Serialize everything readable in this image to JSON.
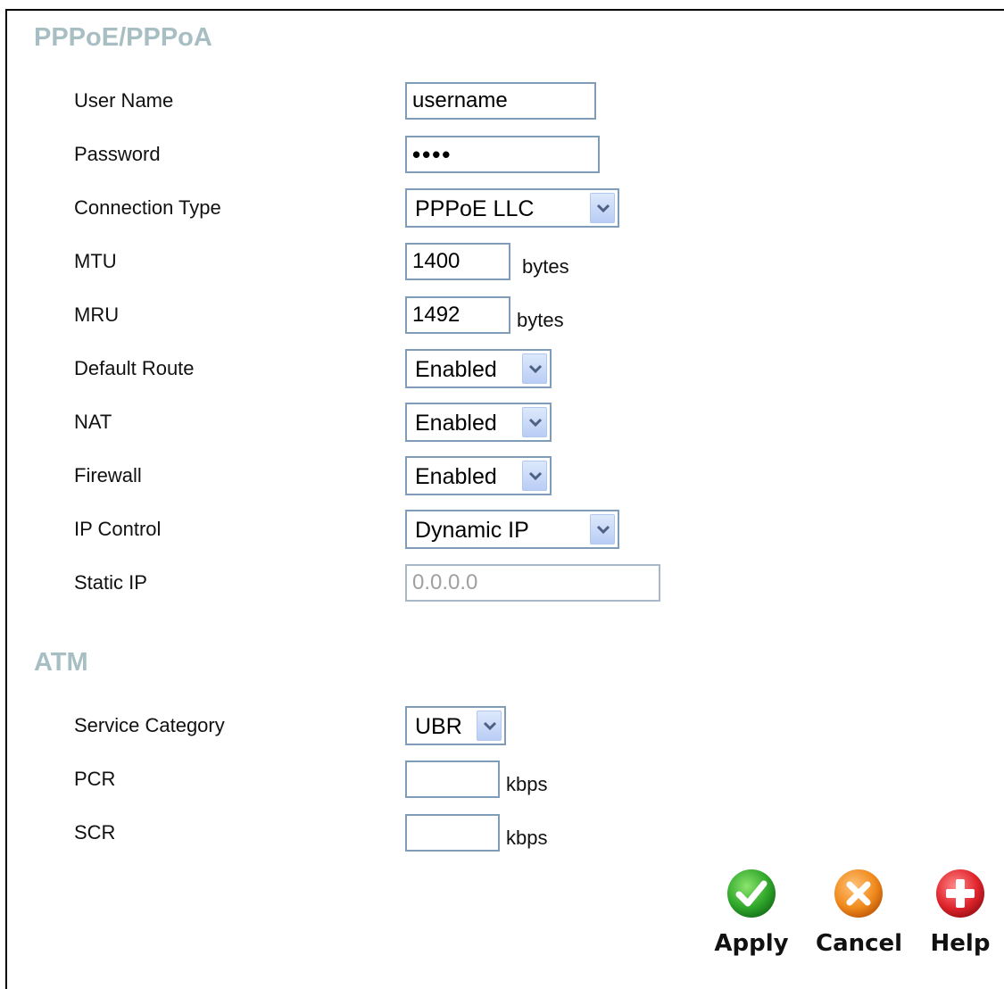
{
  "pppoe": {
    "heading": "PPPoE/PPPoA",
    "username_label": "User Name",
    "username_value": "username",
    "password_label": "Password",
    "password_value": "••••",
    "conn_type_label": "Connection Type",
    "conn_type_value": "PPPoE LLC",
    "mtu_label": "MTU",
    "mtu_value": "1400",
    "mtu_unit": "bytes",
    "mru_label": "MRU",
    "mru_value": "1492",
    "mru_unit": "bytes",
    "default_route_label": "Default Route",
    "default_route_value": "Enabled",
    "nat_label": "NAT",
    "nat_value": "Enabled",
    "firewall_label": "Firewall",
    "firewall_value": "Enabled",
    "ip_control_label": "IP Control",
    "ip_control_value": "Dynamic IP",
    "static_ip_label": "Static IP",
    "static_ip_value": "0.0.0.0"
  },
  "atm": {
    "heading": "ATM",
    "service_category_label": "Service Category",
    "service_category_value": "UBR",
    "pcr_label": "PCR",
    "pcr_value": "",
    "pcr_unit": "kbps",
    "scr_label": "SCR",
    "scr_value": "",
    "scr_unit": "kbps"
  },
  "buttons": {
    "apply": "Apply",
    "cancel": "Cancel",
    "help": "Help"
  },
  "colors": {
    "heading": "#a7bfc3",
    "field_border": "#7f9db9",
    "apply_green": "#3cb52f",
    "cancel_orange": "#f08a1c",
    "help_red": "#e0242c"
  }
}
